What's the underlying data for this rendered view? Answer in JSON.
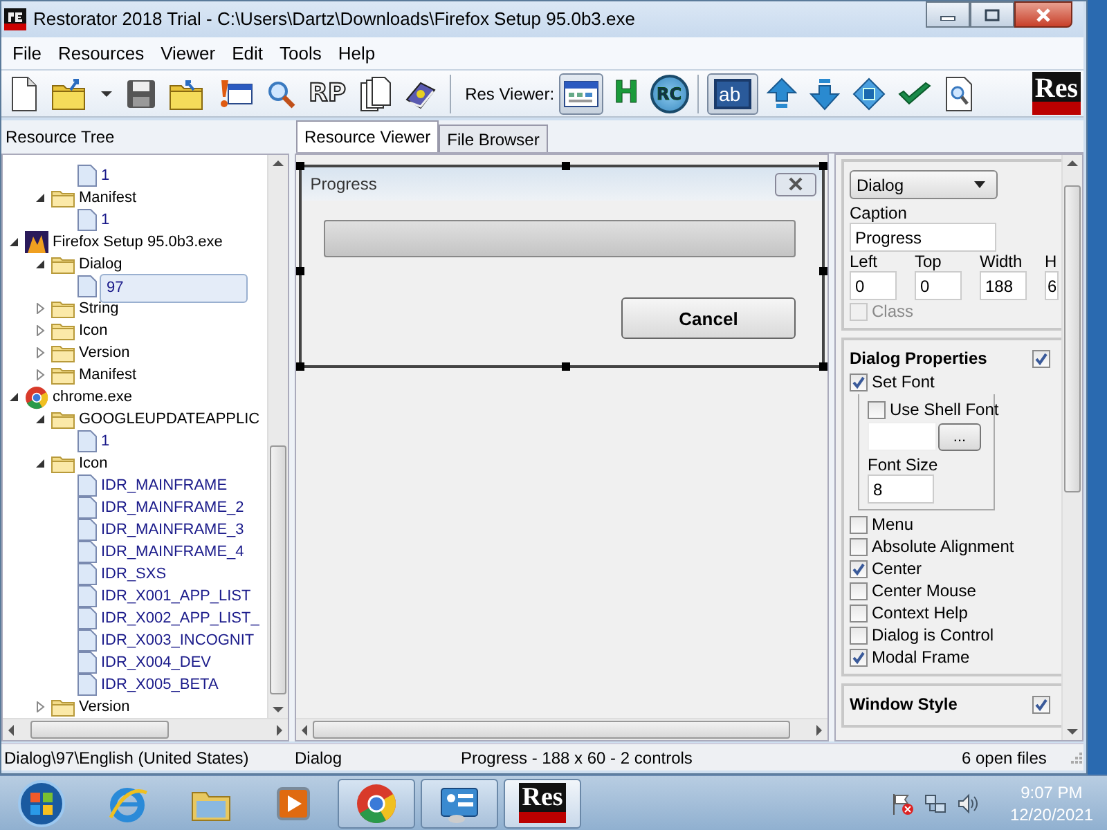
{
  "window": {
    "title": "Restorator 2018 Trial - C:\\Users\\Dartz\\Downloads\\Firefox Setup 95.0b3.exe"
  },
  "menu": [
    "File",
    "Resources",
    "Viewer",
    "Edit",
    "Tools",
    "Help"
  ],
  "toolbar": [
    {
      "kind": "new"
    },
    {
      "kind": "open"
    },
    {
      "kind": "menu"
    },
    {
      "kind": "save"
    },
    {
      "kind": "folder"
    },
    {
      "kind": "alert"
    },
    {
      "kind": "search"
    },
    {
      "kind": "text",
      "label": "RP"
    },
    {
      "kind": "copy"
    },
    {
      "kind": "help"
    },
    {
      "kind": "separator"
    },
    {
      "kind": "label",
      "label": "Res Viewer:"
    },
    {
      "kind": "view",
      "selected": true
    },
    {
      "kind": "text",
      "label": "H",
      "selected": false
    },
    {
      "kind": "circle",
      "label": "RC",
      "selected": false
    },
    {
      "kind": "separator"
    },
    {
      "kind": "toggle",
      "label": "ab",
      "on": true
    },
    {
      "kind": "up"
    },
    {
      "kind": "down"
    },
    {
      "kind": "move"
    },
    {
      "kind": "check"
    },
    {
      "kind": "preview"
    }
  ],
  "logo": "Res",
  "tree": {
    "title": "Resource Tree",
    "items": [
      {
        "children": [
          {
            "children": [
              {
                "kind": "file",
                "label": "1",
                "selected": false
              }
            ]
          },
          {
            "kind": "folder",
            "label": "Manifest",
            "expanded": true,
            "children": [
              {
                "kind": "file",
                "label": "1",
                "selected": false
              }
            ]
          }
        ]
      },
      {
        "kind": "setup",
        "label": "Firefox Setup 95.0b3.exe",
        "expanded": true,
        "children": [
          {
            "kind": "folder",
            "label": "Dialog",
            "expanded": true,
            "children": [
              {
                "kind": "file",
                "label": "97",
                "selected": true
              }
            ]
          },
          {
            "kind": "folder",
            "label": "String",
            "expanded": false
          },
          {
            "kind": "folder",
            "label": "Icon",
            "expanded": false
          },
          {
            "kind": "folder",
            "label": "Version",
            "expanded": false
          },
          {
            "kind": "folder",
            "label": "Manifest",
            "expanded": false
          }
        ]
      },
      {
        "kind": "browser",
        "label": "chrome.exe",
        "expanded": true,
        "children": [
          {
            "kind": "folder",
            "label": "GOOGLEUPDATEAPPLIC",
            "expanded": true,
            "children": [
              {
                "kind": "file",
                "label": "1",
                "selected": false
              }
            ]
          },
          {
            "kind": "folder",
            "label": "Icon",
            "expanded": true,
            "children": [
              {
                "kind": "file",
                "label": "IDR_MAINFRAME",
                "selected": false
              },
              {
                "kind": "file",
                "label": "IDR_MAINFRAME_2",
                "selected": false
              },
              {
                "kind": "file",
                "label": "IDR_MAINFRAME_3",
                "selected": false
              },
              {
                "kind": "file",
                "label": "IDR_MAINFRAME_4",
                "selected": false
              },
              {
                "kind": "file",
                "label": "IDR_SXS",
                "selected": false
              },
              {
                "kind": "file",
                "label": "IDR_X001_APP_LIST",
                "selected": false
              },
              {
                "kind": "file",
                "label": "IDR_X002_APP_LIST_",
                "selected": false
              },
              {
                "kind": "file",
                "label": "IDR_X003_INCOGNIT",
                "selected": false
              },
              {
                "kind": "file",
                "label": "IDR_X004_DEV",
                "selected": false
              },
              {
                "kind": "file",
                "label": "IDR_X005_BETA",
                "selected": false
              }
            ]
          },
          {
            "kind": "folder",
            "label": "Version",
            "expanded": false
          }
        ]
      }
    ]
  },
  "tabs": [
    {
      "label": "Resource Viewer",
      "selected": true
    },
    {
      "label": "File Browser",
      "selected": false
    }
  ],
  "preview": {
    "title": "Progress",
    "progress": {
      "level": 0
    },
    "button": "Cancel"
  },
  "properties": {
    "type_select": "Dialog",
    "caption_label": "Caption",
    "caption": "Progress",
    "geometry": [
      {
        "label": "Left",
        "value": "0"
      },
      {
        "label": "Top",
        "value": "0"
      },
      {
        "label": "Width",
        "value": "188"
      },
      {
        "label": "H",
        "value": "6"
      }
    ],
    "class_option": {
      "label": "Class",
      "checked": false,
      "disabled": true
    },
    "dialog_section": {
      "title": "Dialog Properties",
      "checked": true,
      "set_font": {
        "label": "Set Font",
        "checked": true
      },
      "use_shell_font": {
        "label": "Use Shell Font",
        "checked": false
      },
      "browse_button": "...",
      "font_size_label": "Font Size",
      "font_size": "8",
      "options": [
        {
          "label": "Menu",
          "checked": false
        },
        {
          "label": "Absolute Alignment",
          "checked": false
        },
        {
          "label": "Center",
          "checked": true
        },
        {
          "label": "Center Mouse",
          "checked": false
        },
        {
          "label": "Context Help",
          "checked": false
        },
        {
          "label": "Dialog is Control",
          "checked": false
        },
        {
          "label": "Modal Frame",
          "checked": true
        }
      ]
    },
    "window_style": {
      "title": "Window Style",
      "checked": true
    }
  },
  "status_bar": [
    "Dialog\\97\\English (United States)",
    "Dialog",
    "Progress - 188 x 60 - 2 controls",
    "6 open files"
  ],
  "taskbar": {
    "items": [
      {
        "kind": "ie",
        "open": false,
        "selected": false
      },
      {
        "kind": "explorer",
        "open": false,
        "selected": false
      },
      {
        "kind": "media",
        "open": false,
        "selected": false
      },
      {
        "kind": "chrome",
        "open": true,
        "selected": false
      },
      {
        "kind": "panel",
        "open": true,
        "selected": false
      },
      {
        "kind": "res",
        "label": "Res",
        "open": true,
        "selected": true
      }
    ],
    "time": "9:07 PM",
    "date": "12/20/2021"
  }
}
